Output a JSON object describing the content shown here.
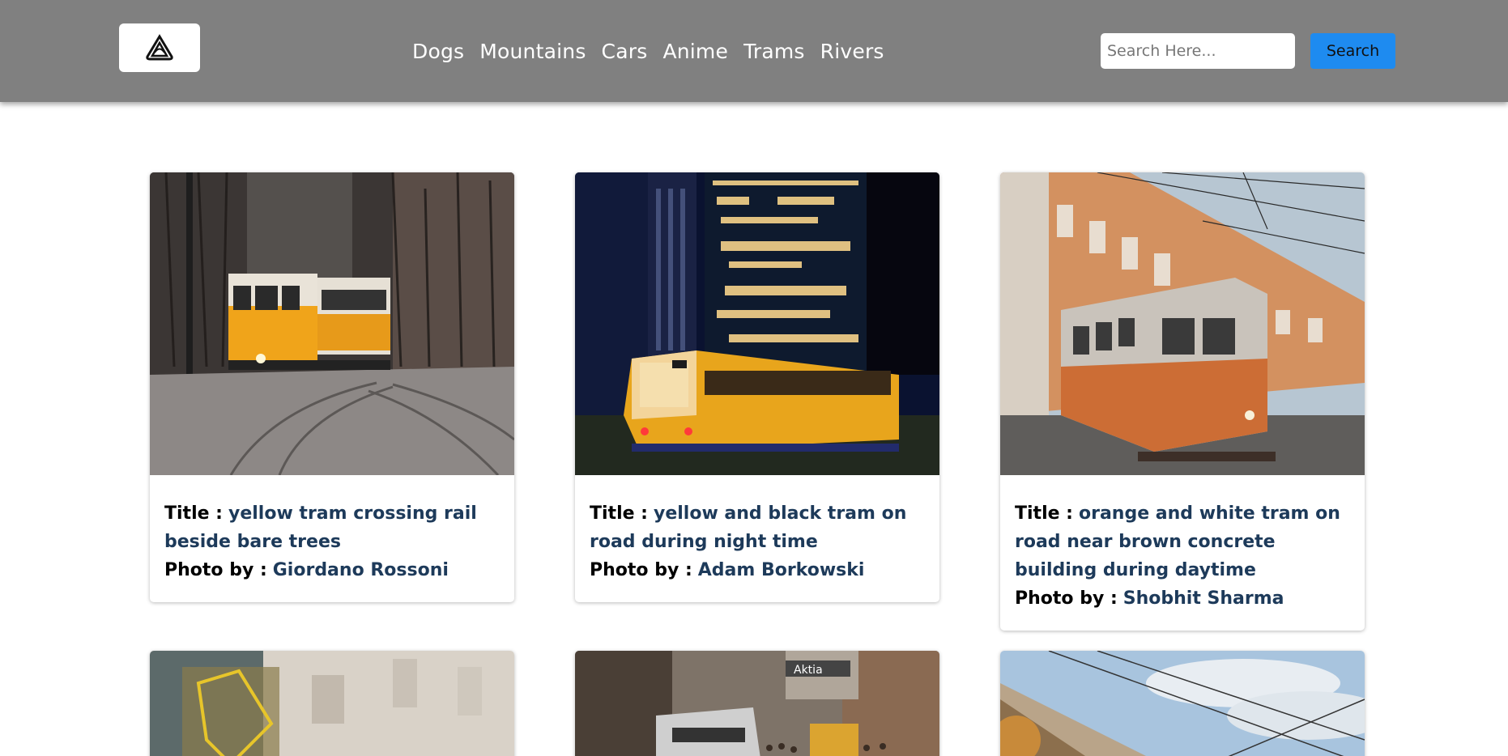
{
  "nav": {
    "logo_icon": "airbnb-style-logo-icon",
    "links": [
      "Dogs",
      "Mountains",
      "Cars",
      "Anime",
      "Trams",
      "Rivers"
    ],
    "search": {
      "placeholder": "Search Here...",
      "value": ""
    },
    "search_button_label": "Search"
  },
  "labels": {
    "title": "Title :",
    "photo_by": "Photo by :"
  },
  "cards": [
    {
      "title": "yellow tram crossing rail beside bare trees",
      "photographer": "Giordano Rossoni",
      "image": "yellow-tram-street-photo"
    },
    {
      "title": "yellow and black tram on road during night time",
      "photographer": "Adam Borkowski",
      "image": "night-tram-skyscraper-photo"
    },
    {
      "title": "orange and white tram on road near brown concrete building during daytime",
      "photographer": "Shobhit Sharma",
      "image": "orange-tram-building-photo"
    }
  ],
  "partial_cards": [
    {
      "image": "blurred-tram-photo"
    },
    {
      "image": "busy-street-tram-photo",
      "visible_sign": "Aktia"
    },
    {
      "image": "overhead-wires-sky-photo"
    }
  ],
  "colors": {
    "navbar": "#808080",
    "search_button": "#1e8bf0",
    "value_text": "#1d3a5a"
  }
}
